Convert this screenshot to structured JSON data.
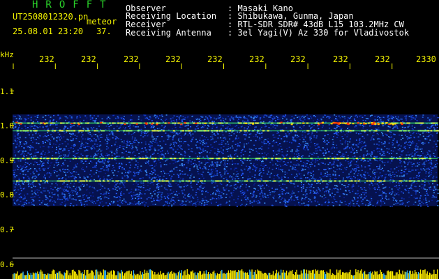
{
  "header": {
    "brand": "HROFFT",
    "filename": "UT2508012320.pn",
    "tag": "meteor",
    "datetime": "25.08.01 23:20",
    "count": "37.",
    "rows": [
      {
        "label": "Observer",
        "value": ": Masaki Kano"
      },
      {
        "label": "Receiving Location",
        "value": ": Shibukawa, Gunma, Japan"
      },
      {
        "label": "Receiver",
        "value": ": RTL-SDR SDR# 43dB L15 103.2MHz CW"
      },
      {
        "label": "Receiving Antenna",
        "value": ": 3el Yagi(V) Az 330 for Vladivostok"
      }
    ]
  },
  "axis": {
    "unit": "kHz",
    "time_ticks": [
      "232",
      "232",
      "232",
      "232",
      "232",
      "232",
      "232",
      "232",
      "232",
      "2330"
    ],
    "freq_ticks": [
      "1.1",
      "1.0",
      "0.9",
      "0.8",
      "0.7",
      "0.6"
    ]
  },
  "colors": {
    "background": "#000000",
    "label_text": "#f4f400",
    "brand_text": "#2bd62b",
    "signal_line": "#33cc66",
    "hot_signal": "#ff3300",
    "noise_base": "#0a1a8c",
    "power_bar": "#ffee00"
  },
  "spectrogram": {
    "freq_range_khz": [
      0.6,
      1.1
    ],
    "band_khz": [
      0.78,
      1.02
    ],
    "carrier_lines_khz": [
      1.007,
      0.985,
      0.905,
      0.84
    ]
  }
}
